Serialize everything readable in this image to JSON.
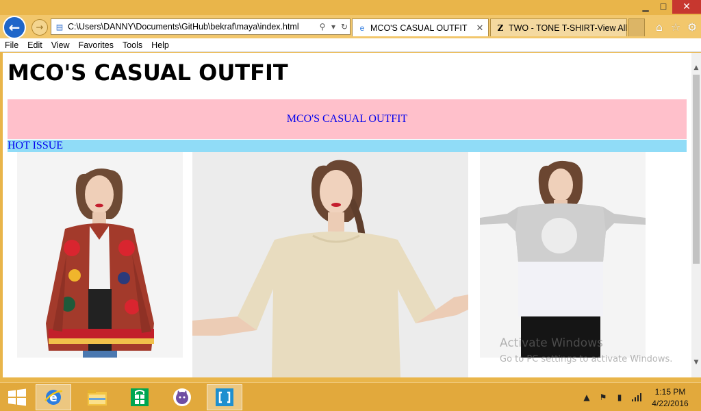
{
  "window": {
    "minimize_glyph": "▁",
    "maximize_glyph": "☐",
    "close_glyph": "✕"
  },
  "browser": {
    "address": "C:\\Users\\DANNY\\Documents\\GitHub\\bekraf\\maya\\index.html",
    "tabs": [
      {
        "label": "MCO'S CASUAL OUTFIT",
        "icon": "ie-page-icon",
        "active": true
      },
      {
        "label": "TWO - TONE T-SHIRT-View All...",
        "icon": "zara-z-icon",
        "active": false
      }
    ],
    "menu": [
      "File",
      "Edit",
      "View",
      "Favorites",
      "Tools",
      "Help"
    ]
  },
  "page": {
    "heading": "MCO'S CASUAL OUTFIT",
    "banner_text": "MCO'S CASUAL OUTFIT",
    "hot_issue": "HOT ISSUE",
    "photos": [
      {
        "subject": "woman-in-embroidered-jacket-photo"
      },
      {
        "subject": "woman-in-beige-tshirt-photo"
      },
      {
        "subject": "woman-in-two-tone-tshirt-photo"
      }
    ],
    "colors": {
      "banner_bg": "#ffc0cb",
      "hot_bar_bg": "#90dcf7",
      "link_text": "#0000ee"
    }
  },
  "watermark": {
    "line1": "Activate Windows",
    "line2": "Go to PC settings to activate Windows."
  },
  "taskbar": {
    "apps": [
      "internet-explorer-icon",
      "file-explorer-icon",
      "store-icon",
      "github-icon",
      "brackets-icon"
    ],
    "time": "1:15 PM",
    "date": "4/22/2016"
  }
}
